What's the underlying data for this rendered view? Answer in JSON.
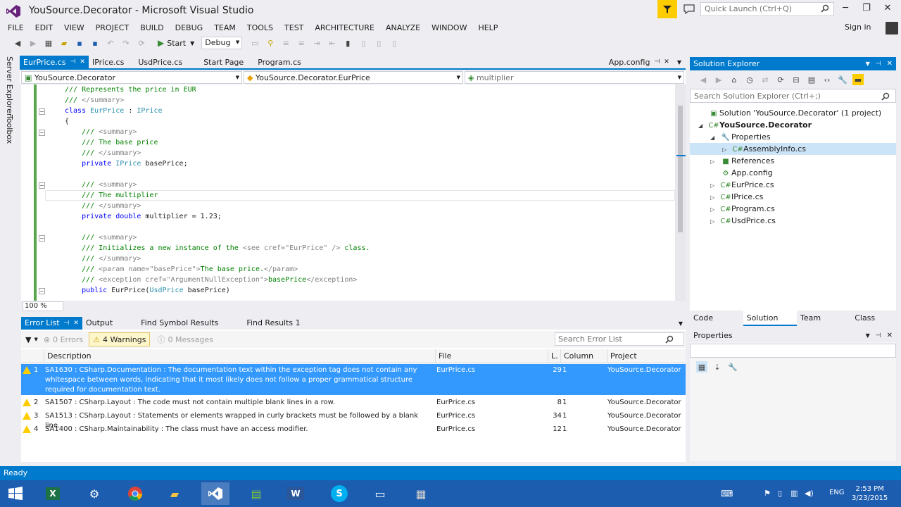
{
  "window": {
    "title": "YouSource.Decorator - Microsoft Visual Studio"
  },
  "quick_launch": {
    "placeholder": "Quick Launch (Ctrl+Q)"
  },
  "menu": [
    "FILE",
    "EDIT",
    "VIEW",
    "PROJECT",
    "BUILD",
    "DEBUG",
    "TEAM",
    "TOOLS",
    "TEST",
    "ARCHITECTURE",
    "ANALYZE",
    "WINDOW",
    "HELP"
  ],
  "signin": "Sign in",
  "toolbar": {
    "start_label": "Start",
    "config": "Debug"
  },
  "left_rail": {
    "server_explorer": "Server Explorer",
    "toolbox": "Toolbox"
  },
  "doc_tabs": [
    "EurPrice.cs",
    "IPrice.cs",
    "UsdPrice.cs",
    "Start Page",
    "Program.cs"
  ],
  "doc_tab_right": "App.config",
  "nav": {
    "project": "YouSource.Decorator",
    "class": "YouSource.Decorator.EurPrice",
    "member": "multiplier"
  },
  "code_lines": [
    {
      "parts": [
        {
          "t": "/// ",
          "c": "cm"
        },
        {
          "t": "Represents the price in EUR",
          "c": "cm"
        }
      ]
    },
    {
      "parts": [
        {
          "t": "/// ",
          "c": "cm"
        },
        {
          "t": "</summary>",
          "c": "xd"
        }
      ]
    },
    {
      "parts": [
        {
          "t": "class ",
          "c": "kw"
        },
        {
          "t": "EurPrice",
          "c": "ty"
        },
        {
          "t": " : ",
          "c": ""
        },
        {
          "t": "IPrice",
          "c": "ty"
        }
      ]
    },
    {
      "parts": [
        {
          "t": "{",
          "c": ""
        }
      ]
    },
    {
      "parts": [
        {
          "t": "    /// ",
          "c": "cm"
        },
        {
          "t": "<summary>",
          "c": "xd"
        }
      ]
    },
    {
      "parts": [
        {
          "t": "    /// ",
          "c": "cm"
        },
        {
          "t": "The base price",
          "c": "cm"
        }
      ]
    },
    {
      "parts": [
        {
          "t": "    /// ",
          "c": "cm"
        },
        {
          "t": "</summary>",
          "c": "xd"
        }
      ]
    },
    {
      "parts": [
        {
          "t": "    private ",
          "c": "kw"
        },
        {
          "t": "IPrice",
          "c": "ty"
        },
        {
          "t": " basePrice;",
          "c": ""
        }
      ]
    },
    {
      "parts": [
        {
          "t": "",
          "c": ""
        }
      ]
    },
    {
      "parts": [
        {
          "t": "    /// ",
          "c": "cm"
        },
        {
          "t": "<summary>",
          "c": "xd"
        }
      ]
    },
    {
      "parts": [
        {
          "t": "    /// ",
          "c": "cm"
        },
        {
          "t": "The multiplier",
          "c": "cm"
        }
      ]
    },
    {
      "parts": [
        {
          "t": "    /// ",
          "c": "cm"
        },
        {
          "t": "</summary>",
          "c": "xd"
        }
      ]
    },
    {
      "parts": [
        {
          "t": "    private double ",
          "c": "kw"
        },
        {
          "t": "multiplier = 1.23;",
          "c": ""
        }
      ]
    },
    {
      "parts": [
        {
          "t": "",
          "c": ""
        }
      ]
    },
    {
      "parts": [
        {
          "t": "    /// ",
          "c": "cm"
        },
        {
          "t": "<summary>",
          "c": "xd"
        }
      ]
    },
    {
      "parts": [
        {
          "t": "    /// ",
          "c": "cm"
        },
        {
          "t": "Initializes a new instance of the ",
          "c": "cm"
        },
        {
          "t": "<see cref=\"EurPrice\" />",
          "c": "xd"
        },
        {
          "t": " class.",
          "c": "cm"
        }
      ]
    },
    {
      "parts": [
        {
          "t": "    /// ",
          "c": "cm"
        },
        {
          "t": "</summary>",
          "c": "xd"
        }
      ]
    },
    {
      "parts": [
        {
          "t": "    /// ",
          "c": "cm"
        },
        {
          "t": "<param name=\"basePrice\">",
          "c": "xd"
        },
        {
          "t": "The base price.",
          "c": "cm"
        },
        {
          "t": "</param>",
          "c": "xd"
        }
      ]
    },
    {
      "parts": [
        {
          "t": "    /// ",
          "c": "cm"
        },
        {
          "t": "<exception cref=\"ArgumentNullException\">",
          "c": "xd"
        },
        {
          "t": "basePrice",
          "c": "cm"
        },
        {
          "t": "</exception>",
          "c": "xd"
        }
      ]
    },
    {
      "parts": [
        {
          "t": "    public ",
          "c": "kw"
        },
        {
          "t": "EurPrice(",
          "c": ""
        },
        {
          "t": "UsdPrice",
          "c": "ty"
        },
        {
          "t": " basePrice)",
          "c": ""
        }
      ]
    }
  ],
  "zoom": "100 %",
  "solution_explorer": {
    "title": "Solution Explorer",
    "search_placeholder": "Search Solution Explorer (Ctrl+;)",
    "tree": [
      {
        "label": "Solution 'YouSource.Decorator' (1 project)",
        "depth": 0,
        "arrow": "",
        "icon": "▣",
        "bold": false
      },
      {
        "label": "YouSource.Decorator",
        "depth": 0,
        "arrow": "◢",
        "icon": "C#",
        "bold": true
      },
      {
        "label": "Properties",
        "depth": 1,
        "arrow": "◢",
        "icon": "🔧",
        "bold": false
      },
      {
        "label": "AssemblyInfo.cs",
        "depth": 2,
        "arrow": "▷",
        "icon": "C#",
        "bold": false,
        "selected": true
      },
      {
        "label": "References",
        "depth": 1,
        "arrow": "▷",
        "icon": "■",
        "bold": false
      },
      {
        "label": "App.config",
        "depth": 1,
        "arrow": "",
        "icon": "⚙",
        "bold": false
      },
      {
        "label": "EurPrice.cs",
        "depth": 1,
        "arrow": "▷",
        "icon": "C#",
        "bold": false
      },
      {
        "label": "IPrice.cs",
        "depth": 1,
        "arrow": "▷",
        "icon": "C#",
        "bold": false
      },
      {
        "label": "Program.cs",
        "depth": 1,
        "arrow": "▷",
        "icon": "C#",
        "bold": false
      },
      {
        "label": "UsdPrice.cs",
        "depth": 1,
        "arrow": "▷",
        "icon": "C#",
        "bold": false
      }
    ],
    "tabs": [
      "Code Analy...",
      "Solution Ex...",
      "Team Explo...",
      "Class View"
    ]
  },
  "properties": {
    "title": "Properties"
  },
  "error_list": {
    "tabs": [
      "Error List",
      "Output",
      "Find Symbol Results",
      "Find Results 1"
    ],
    "errors_label": "0 Errors",
    "warnings_label": "4 Warnings",
    "messages_label": "0 Messages",
    "search_placeholder": "Search Error List",
    "columns": [
      "Description",
      "File",
      "L.",
      "Column",
      "Project"
    ],
    "rows": [
      {
        "num": "1",
        "desc": "SA1630 : CSharp.Documentation : The documentation text within the exception tag does not contain any whitespace between words, indicating that it most likely does not follow a proper grammatical structure required for documentation text.",
        "file": "EurPrice.cs",
        "line": "29",
        "col": "1",
        "project": "YouSource.Decorator"
      },
      {
        "num": "2",
        "desc": "SA1507 : CSharp.Layout : The code must not contain multiple blank lines in a row.",
        "file": "EurPrice.cs",
        "line": "8",
        "col": "1",
        "project": "YouSource.Decorator"
      },
      {
        "num": "3",
        "desc": "SA1513 : CSharp.Layout : Statements or elements wrapped in curly brackets must be followed by a blank line.",
        "file": "EurPrice.cs",
        "line": "34",
        "col": "1",
        "project": "YouSource.Decorator"
      },
      {
        "num": "4",
        "desc": "SA1400 : CSharp.Maintainability : The class must have an access modifier.",
        "file": "EurPrice.cs",
        "line": "12",
        "col": "1",
        "project": "YouSource.Decorator"
      }
    ]
  },
  "status": "Ready",
  "taskbar": {
    "lang": "ENG",
    "time": "2:53 PM",
    "date": "3/23/2015"
  },
  "colors": {
    "accent": "#007acc",
    "selection": "#3399ff",
    "warning": "#ffcc00",
    "taskbar": "#1c5db0"
  }
}
